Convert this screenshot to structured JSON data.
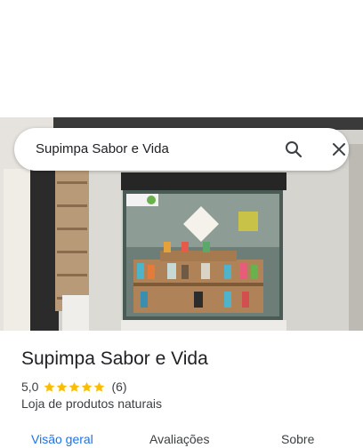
{
  "search": {
    "query": "Supimpa Sabor e Vida"
  },
  "place": {
    "name": "Supimpa Sabor e Vida",
    "rating": "5,0",
    "stars": 5,
    "review_count": "(6)",
    "category": "Loja de produtos naturais"
  },
  "tabs": [
    {
      "label": "Visão geral",
      "active": true
    },
    {
      "label": "Avaliações",
      "active": false
    },
    {
      "label": "Sobre",
      "active": false
    }
  ],
  "colors": {
    "accent": "#1a73e8",
    "star": "#fbbc04",
    "text_primary": "#202124",
    "text_secondary": "#3c4043"
  }
}
